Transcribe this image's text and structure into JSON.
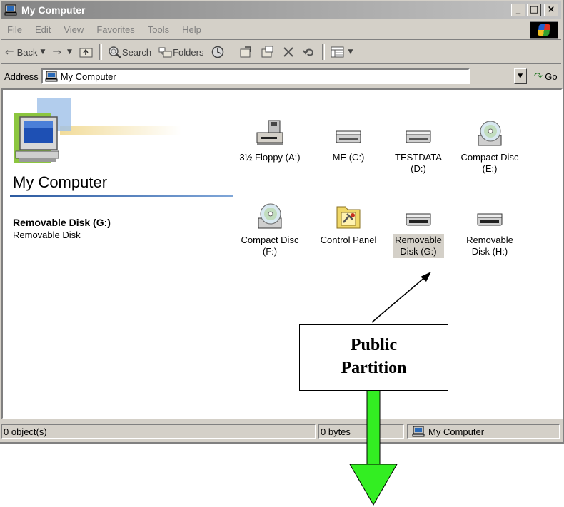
{
  "window": {
    "title": "My Computer",
    "controls": {
      "minimize": "_",
      "maximize": "□",
      "close": "×"
    }
  },
  "menubar": {
    "items": [
      "File",
      "Edit",
      "View",
      "Favorites",
      "Tools",
      "Help"
    ]
  },
  "toolbar": {
    "back_label": "Back",
    "search_label": "Search",
    "folders_label": "Folders"
  },
  "address": {
    "label": "Address",
    "value": "My Computer",
    "go_label": "Go"
  },
  "leftpane": {
    "title": "My Computer",
    "selected_name": "Removable Disk (G:)",
    "selected_type": "Removable Disk"
  },
  "items": [
    {
      "line1": "3½ Floppy (A:)",
      "line2": "",
      "icon": "floppy-drive-icon"
    },
    {
      "line1": "ME (C:)",
      "line2": "",
      "icon": "hard-drive-icon"
    },
    {
      "line1": "TESTDATA",
      "line2": "(D:)",
      "icon": "hard-drive-icon"
    },
    {
      "line1": "Compact Disc",
      "line2": "(E:)",
      "icon": "cd-drive-icon"
    },
    {
      "line1": "Compact Disc",
      "line2": "(F:)",
      "icon": "cd-drive-icon"
    },
    {
      "line1": "Control Panel",
      "line2": "",
      "icon": "control-panel-icon"
    },
    {
      "line1": "Removable",
      "line2": "Disk (G:)",
      "icon": "removable-drive-icon",
      "selected": true
    },
    {
      "line1": "Removable",
      "line2": "Disk (H:)",
      "icon": "removable-drive-icon"
    }
  ],
  "statusbar": {
    "objects": "0 object(s)",
    "size": "0 bytes",
    "zone": "My Computer"
  },
  "annotation": {
    "line1": "Public",
    "line2": "Partition",
    "arrow_color": "#33ee22"
  }
}
